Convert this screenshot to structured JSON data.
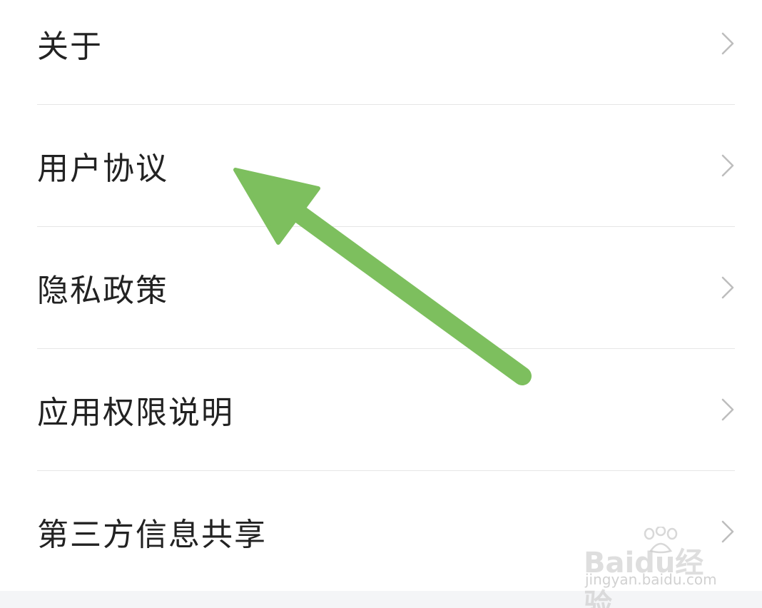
{
  "menu": {
    "items": [
      {
        "label": "关于"
      },
      {
        "label": "用户协议"
      },
      {
        "label": "隐私政策"
      },
      {
        "label": "应用权限说明"
      },
      {
        "label": "第三方信息共享"
      }
    ]
  },
  "annotation": {
    "arrow_color": "#7dbf5e",
    "icon": "arrow-icon"
  },
  "watermark": {
    "brand": "Baidu经验",
    "url": "jingyan.baidu.com"
  },
  "colors": {
    "text": "#222222",
    "chevron": "#bdbdbd",
    "divider": "#e6e6e6",
    "footer": "#f4f5f7"
  }
}
